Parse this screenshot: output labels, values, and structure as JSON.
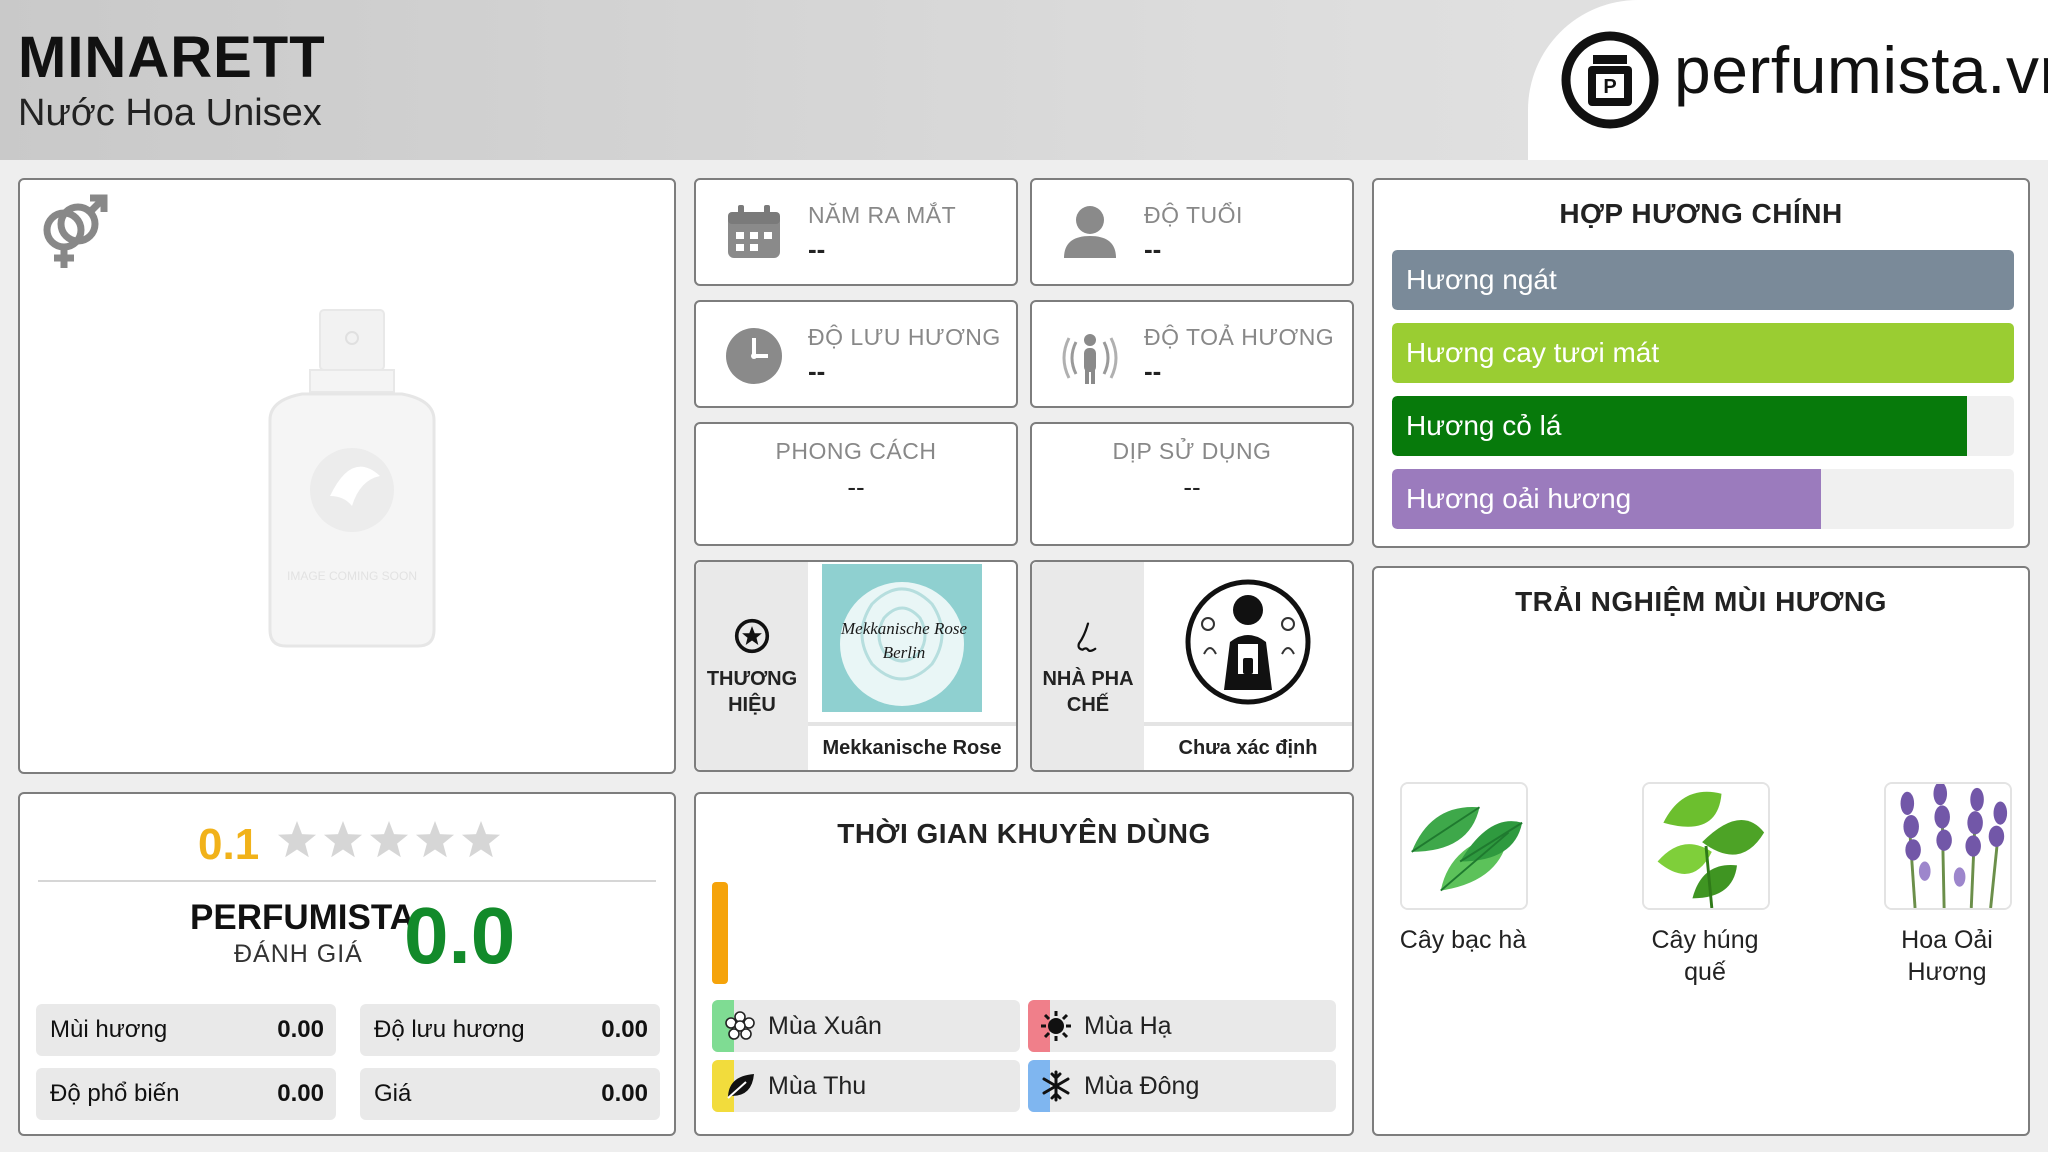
{
  "header": {
    "title": "MINARETT",
    "subtitle": "Nước Hoa Unisex",
    "logo_text": "perfumista.vn"
  },
  "product_image": {
    "placeholder_text": "IMAGE COMING SOON",
    "gender_icon": "male-female-icon"
  },
  "info": {
    "launch_year": {
      "label": "NĂM RA MẮT",
      "value": "--",
      "icon": "calendar-icon"
    },
    "age": {
      "label": "ĐỘ TUỔI",
      "value": "--",
      "icon": "person-icon"
    },
    "longevity": {
      "label": "ĐỘ LƯU HƯƠNG",
      "value": "--",
      "icon": "clock-icon"
    },
    "sillage": {
      "label": "ĐỘ TOẢ HƯƠNG",
      "value": "--",
      "icon": "sillage-icon"
    },
    "style": {
      "label": "PHONG CÁCH",
      "value": "--"
    },
    "occasion": {
      "label": "DỊP SỬ DỤNG",
      "value": "--"
    }
  },
  "brand": {
    "label_line1": "THƯƠNG",
    "label_line2": "HIỆU",
    "logo_line1": "Mekkanische Rose",
    "logo_line2": "Berlin",
    "name": "Mekkanische Rose",
    "icon": "star-badge-icon"
  },
  "perfumer": {
    "label_line1": "NHÀ PHA",
    "label_line2": "CHẾ",
    "name": "Chưa xác định",
    "icon": "nose-icon"
  },
  "accords": {
    "title": "HỢP HƯƠNG CHÍNH",
    "items": [
      {
        "label": "Hương ngát",
        "fraction": 1.0,
        "color": "#7a8a99"
      },
      {
        "label": "Hương cay tươi mát",
        "fraction": 1.0,
        "color": "#9acd32"
      },
      {
        "label": "Hương cỏ lá",
        "fraction": 0.925,
        "color": "#077a0b"
      },
      {
        "label": "Hương oải hương",
        "fraction": 0.69,
        "color": "#9b7bbd"
      }
    ]
  },
  "experience": {
    "title": "TRẢI NGHIỆM MÙI HƯƠNG",
    "notes": [
      {
        "label_line1": "Cây bạc hà",
        "label_line2": "",
        "icon": "mint-leaf-icon"
      },
      {
        "label_line1": "Cây húng",
        "label_line2": "quế",
        "icon": "basil-leaf-icon"
      },
      {
        "label_line1": "Hoa Oải",
        "label_line2": "Hương",
        "icon": "lavender-icon"
      }
    ]
  },
  "rating": {
    "score": "0.1",
    "stars_total": 5,
    "stars_filled": 0,
    "perfumista_label": "PERFUMISTA",
    "perfumista_sub": "ĐÁNH GIÁ",
    "perfumista_score": "0.0",
    "metrics": [
      {
        "label": "Mùi hương",
        "value": "0.00"
      },
      {
        "label": "Độ lưu hương",
        "value": "0.00"
      },
      {
        "label": "Độ phổ biến",
        "value": "0.00"
      },
      {
        "label": "Giá",
        "value": "0.00"
      }
    ]
  },
  "recommend": {
    "title": "THỜI GIAN KHUYÊN DÙNG",
    "seasons": [
      {
        "label": "Mùa Xuân",
        "color": "#7fdc93",
        "icon": "flower-icon"
      },
      {
        "label": "Mùa Hạ",
        "color": "#f07f8a",
        "icon": "sun-icon"
      },
      {
        "label": "Mùa Thu",
        "color": "#f2dc3c",
        "icon": "leaf-icon"
      },
      {
        "label": "Mùa Đông",
        "color": "#7fb6f0",
        "icon": "snowflake-icon"
      }
    ]
  }
}
